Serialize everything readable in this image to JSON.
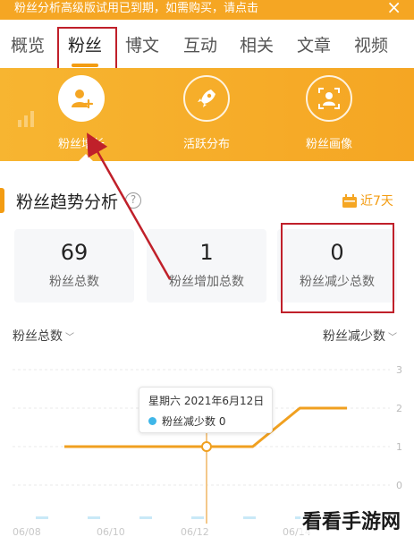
{
  "banner": {
    "text": "粉丝分析高级版试用已到期，如需购买，请点击",
    "close": "×"
  },
  "tabs": [
    {
      "label": "概览",
      "active": false
    },
    {
      "label": "粉丝",
      "active": true
    },
    {
      "label": "博文",
      "active": false
    },
    {
      "label": "互动",
      "active": false
    },
    {
      "label": "相关",
      "active": false
    },
    {
      "label": "文章",
      "active": false
    },
    {
      "label": "视频",
      "active": false
    }
  ],
  "features": [
    {
      "label": "粉丝增长",
      "icon": "user-add-icon"
    },
    {
      "label": "活跃分布",
      "icon": "rocket-icon"
    },
    {
      "label": "粉丝画像",
      "icon": "portrait-icon"
    }
  ],
  "section": {
    "title": "粉丝趋势分析",
    "help": "?",
    "range_label": "近7天"
  },
  "stats": [
    {
      "value": "69",
      "label": "粉丝总数"
    },
    {
      "value": "1",
      "label": "粉丝增加总数"
    },
    {
      "value": "0",
      "label": "粉丝减少总数"
    }
  ],
  "chart_controls": {
    "left_metric": "粉丝总数",
    "right_metric": "粉丝减少数"
  },
  "chart_data": {
    "type": "line",
    "y_right_ticks": [
      "3",
      "2",
      "1",
      "0"
    ],
    "x_tick_labels": [
      "06/08",
      "06/10",
      "06/12",
      "06/14"
    ],
    "series": [
      {
        "values": [
          1,
          1,
          1,
          1,
          1,
          2,
          2
        ],
        "color": "#f0a020"
      }
    ]
  },
  "tooltip": {
    "date": "星期六 2021年6月12日",
    "series_label": "粉丝减少数",
    "value": "0"
  },
  "watermark": "看看手游网",
  "colors": {
    "accent": "#f5a623",
    "annotation": "#c0202a",
    "tooltip_dot": "#3fb6e8"
  }
}
